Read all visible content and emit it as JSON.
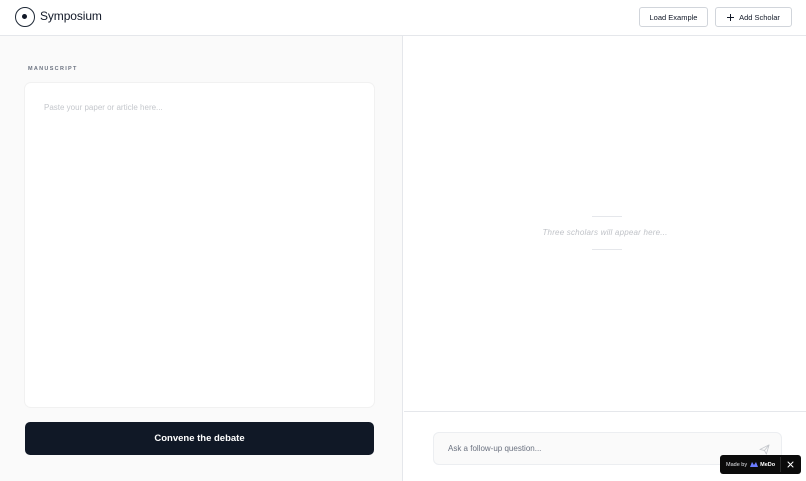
{
  "header": {
    "app_title": "Symposium",
    "load_example_label": "Load Example",
    "add_scholar_label": "Add Scholar"
  },
  "left": {
    "section_label": "MANUSCRIPT",
    "manuscript_placeholder": "Paste your paper or article here...",
    "convene_label": "Convene the debate"
  },
  "right": {
    "empty_text": "Three scholars will appear here...",
    "chat_placeholder": "Ask a follow-up question..."
  },
  "badge": {
    "made_by": "Made by",
    "brand": "MeDo"
  },
  "icons": {
    "logo": "circle-dot-icon",
    "add": "plus-icon",
    "send": "send-icon",
    "close": "close-icon"
  },
  "colors": {
    "primary_button": "#101826",
    "border": "#e5e7eb",
    "left_background": "#fafafa"
  }
}
